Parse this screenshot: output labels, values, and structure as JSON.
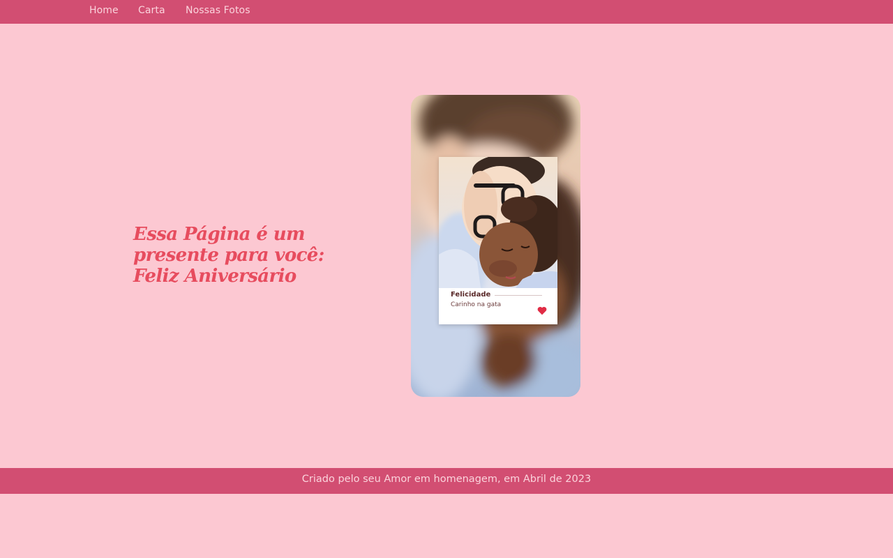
{
  "nav": {
    "items": [
      {
        "label": "Home"
      },
      {
        "label": "Carta"
      },
      {
        "label": "Nossas Fotos"
      }
    ]
  },
  "hero": {
    "headline": "Essa Página é um presente para você: Feliz Aniversário"
  },
  "photo_card": {
    "title": "Felicidade",
    "subtitle": "Carinho na gata",
    "icon": "heart-icon"
  },
  "footer": {
    "text": "Criado pelo seu Amor em homenagem, em Abril de 2023"
  },
  "colors": {
    "background": "#fcc8d2",
    "bar": "#d24e72",
    "bar_text": "#fbd3dc",
    "headline": "#e74c5e",
    "heart": "#e02c45"
  }
}
